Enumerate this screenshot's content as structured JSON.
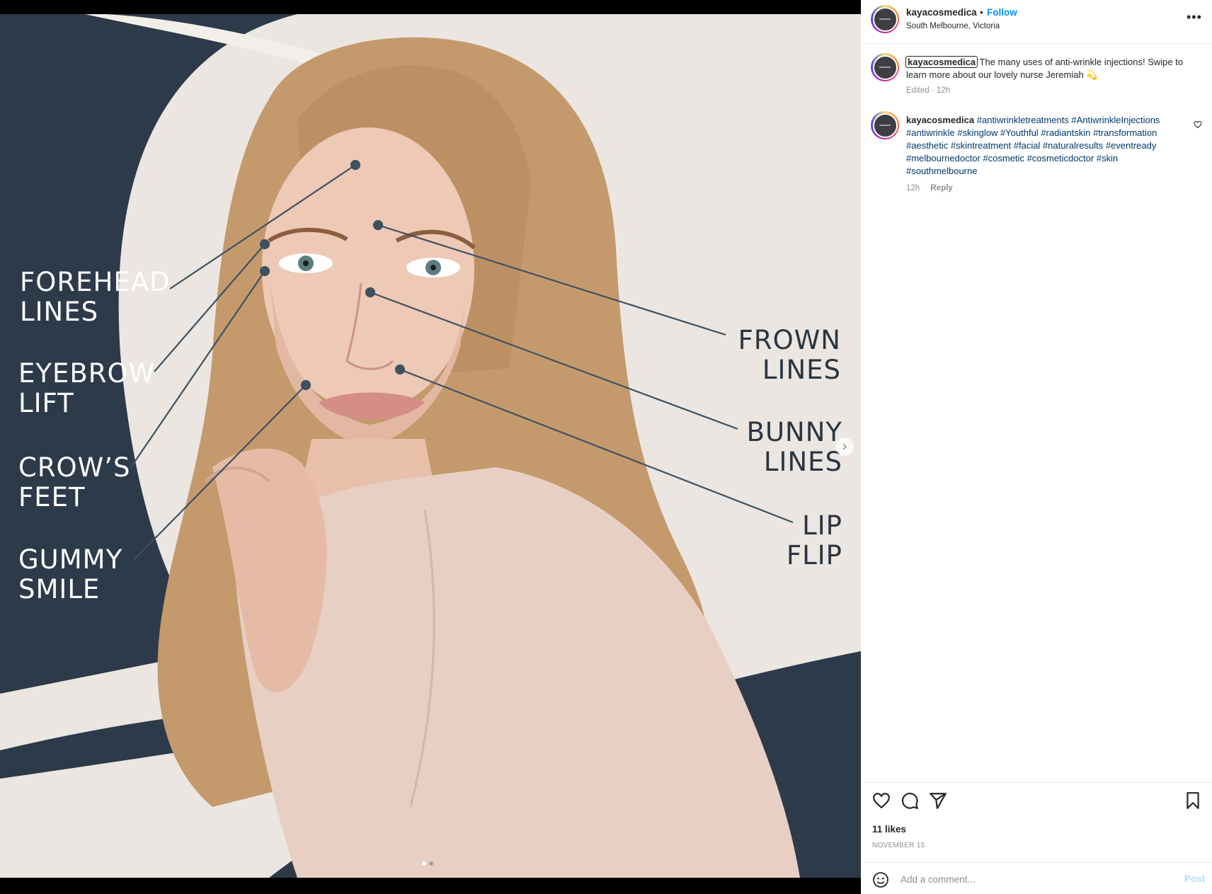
{
  "media": {
    "labels_left": [
      {
        "line1": "FOREHEAD",
        "line2": "LINES"
      },
      {
        "line1": "EYEBROW",
        "line2": "LIFT"
      },
      {
        "line1": "CROW’S",
        "line2": "FEET"
      },
      {
        "line1": "GUMMY",
        "line2": "SMILE"
      }
    ],
    "labels_right": [
      {
        "line1": "FROWN",
        "line2": "LINES"
      },
      {
        "line1": "BUNNY",
        "line2": "LINES"
      },
      {
        "line1": "LIP",
        "line2": "FLIP"
      }
    ],
    "slide_count": 2,
    "active_slide": 1
  },
  "header": {
    "username": "kayacosmedica",
    "separator": "•",
    "follow_label": "Follow",
    "location": "South Melbourne, Victoria",
    "more_icon": "more-options-icon"
  },
  "caption": {
    "username": "kayacosmedica",
    "text": "The many uses of anti-wrinkle injections! Swipe to learn more about our lovely nurse Jeremiah 💫",
    "meta": "Edited · 12h"
  },
  "comment": {
    "username": "kayacosmedica",
    "hashtags": "#antiwrinkletreatments #AntiwrinkleInjections #antiwrinkle #skinglow #Youthful #radiantskin #transformation #aesthetic #skintreatment #facial #naturalresults #eventready #melbournedoctor #cosmetic #cosmeticdoctor #skin #southmelbourne",
    "time": "12h",
    "reply_label": "Reply"
  },
  "actions": {
    "likes": "11 likes",
    "date": "NOVEMBER 15"
  },
  "comment_box": {
    "placeholder": "Add a comment...",
    "post_label": "Post"
  },
  "colors": {
    "navy": "#2d3a4a",
    "cream": "#ebe6e1",
    "link_blue": "#0095f6",
    "hashtag": "#00376b"
  }
}
